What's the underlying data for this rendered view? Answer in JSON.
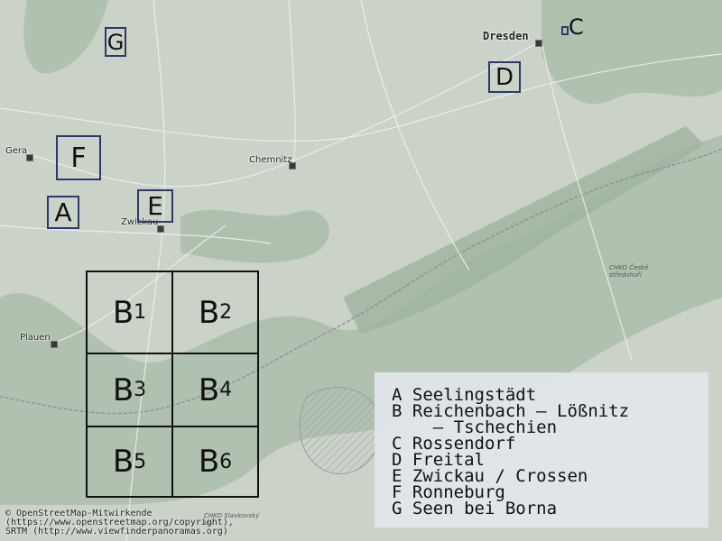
{
  "cities": [
    {
      "id": "dresden",
      "name": "Dresden"
    },
    {
      "id": "gera",
      "name": "Gera"
    },
    {
      "id": "chemnitz",
      "name": "Chemnitz"
    },
    {
      "id": "zwickau",
      "name": "Zwickau"
    },
    {
      "id": "plauen",
      "name": "Plauen"
    }
  ],
  "markers": {
    "A": "A",
    "C": "C",
    "D": "D",
    "E": "E",
    "F": "F",
    "G": "G"
  },
  "grid": {
    "letter": "B",
    "cells": [
      "1",
      "2",
      "3",
      "4",
      "5",
      "6"
    ]
  },
  "legend": {
    "items": [
      "A Seelingstädt",
      "B Reichenbach – Lößnitz",
      "    – Tschechien",
      "C Rossendorf",
      "D Freital",
      "E Zwickau / Crossen",
      "F Ronneburg",
      "G Seen bei Borna"
    ]
  },
  "attribution": {
    "line1": "© OpenStreetMap-Mitwirkende",
    "line2": "(https://www.openstreetmap.org/copyright),",
    "line3": "SRTM (http://www.viewfinderpanoramas.org)"
  },
  "map_tags": {
    "chko_ceske": "CHKO České",
    "chko_ceske2": "středohoří",
    "chko_slavkovsky": "CHKO Slavkovský",
    "chko_slavkovsky2": "les"
  },
  "colors": {
    "land": "#c9d2c8",
    "forest": "#a9bba8",
    "marker_border": "#2b3a6b",
    "grid_border": "#111111",
    "legend_bg": "#e1e6eb"
  }
}
